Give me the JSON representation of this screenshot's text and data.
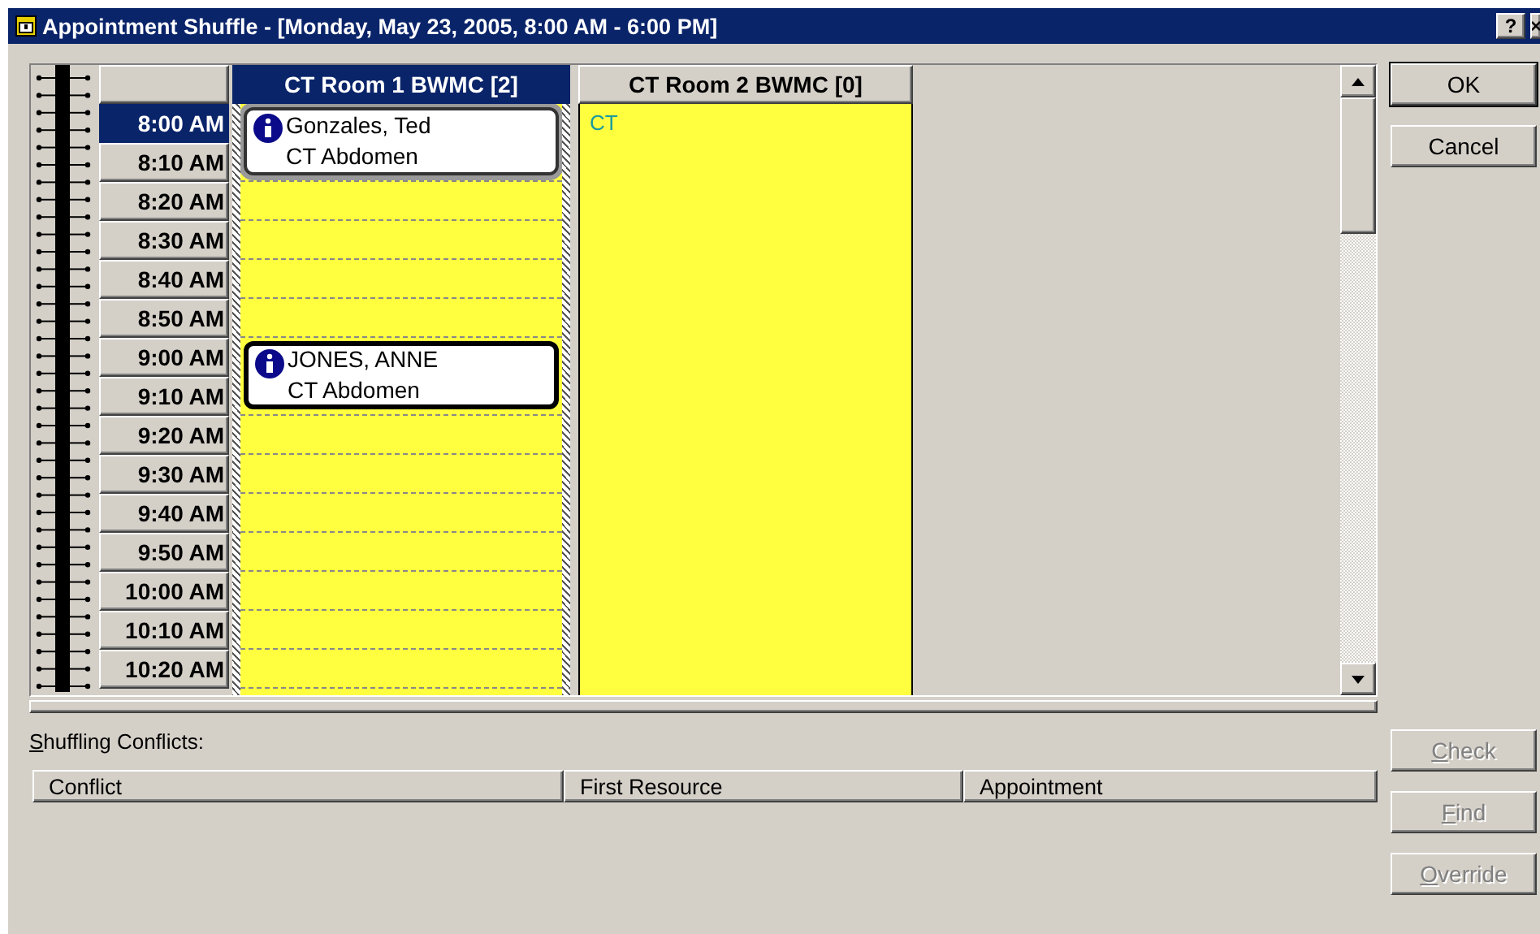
{
  "window": {
    "title": "Appointment Shuffle - [Monday, May 23, 2005, 8:00 AM - 6:00 PM]",
    "help": "?"
  },
  "times": [
    {
      "label": "8:00 AM",
      "selected": true
    },
    {
      "label": "8:10 AM",
      "selected": false
    },
    {
      "label": "8:20 AM",
      "selected": false
    },
    {
      "label": "8:30 AM",
      "selected": false
    },
    {
      "label": "8:40 AM",
      "selected": false
    },
    {
      "label": "8:50 AM",
      "selected": false
    },
    {
      "label": "9:00 AM",
      "selected": false
    },
    {
      "label": "9:10 AM",
      "selected": false
    },
    {
      "label": "9:20 AM",
      "selected": false
    },
    {
      "label": "9:30 AM",
      "selected": false
    },
    {
      "label": "9:40 AM",
      "selected": false
    },
    {
      "label": "9:50 AM",
      "selected": false
    },
    {
      "label": "10:00 AM",
      "selected": false
    },
    {
      "label": "10:10 AM",
      "selected": false
    },
    {
      "label": "10:20 AM",
      "selected": false
    }
  ],
  "resources": [
    {
      "name": "CT Room 1 BWMC [2]",
      "selected": true,
      "rows": [
        {
          "kind": "appointment",
          "patient": "Gonzales, Ted",
          "procedure": "CT Abdomen",
          "selected": true
        },
        {
          "kind": "empty"
        },
        {
          "kind": "empty"
        },
        {
          "kind": "empty"
        },
        {
          "kind": "empty"
        },
        {
          "kind": "appointment",
          "patient": "JONES, ANNE",
          "procedure": "CT Abdomen",
          "selected": false
        },
        {
          "kind": "empty"
        },
        {
          "kind": "empty"
        },
        {
          "kind": "empty"
        },
        {
          "kind": "empty"
        },
        {
          "kind": "empty"
        },
        {
          "kind": "empty"
        },
        {
          "kind": "empty"
        }
      ]
    },
    {
      "name": "CT Room 2 BWMC [0]",
      "selected": false,
      "label": "CT"
    }
  ],
  "buttons": [
    {
      "label": "OK",
      "default": true
    },
    {
      "label": "Cancel",
      "default": false
    }
  ],
  "conflicts": {
    "label": "Shuffling Conflicts:",
    "columns": [
      "Conflict",
      "First Resource",
      "Appointment"
    ]
  },
  "conflict_buttons": [
    {
      "label": "Check",
      "disabled": true
    },
    {
      "label": "Find",
      "disabled": true
    },
    {
      "label": "Override",
      "disabled": true
    }
  ]
}
